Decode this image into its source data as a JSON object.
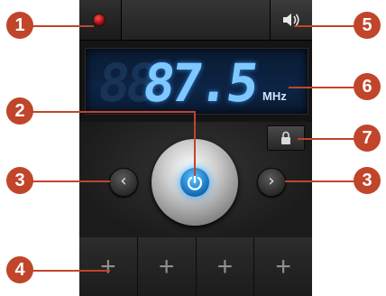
{
  "display": {
    "frequency": "87.5",
    "ghost_digits": "88",
    "unit": "MHz"
  },
  "controls": {
    "prev_label": "‹",
    "next_label": "›"
  },
  "favorites": {
    "slots": [
      "+",
      "+",
      "+",
      "+"
    ]
  },
  "callouts": [
    "1",
    "2",
    "3",
    "3",
    "4",
    "5",
    "6",
    "7"
  ],
  "colors": {
    "callout": "#c0452a",
    "display_text": "#7fc8ff",
    "power_blue": "#1e88e5"
  },
  "icons": {
    "record": "record-icon",
    "speaker": "speaker-icon",
    "power": "power-icon",
    "lock": "lock-icon"
  }
}
